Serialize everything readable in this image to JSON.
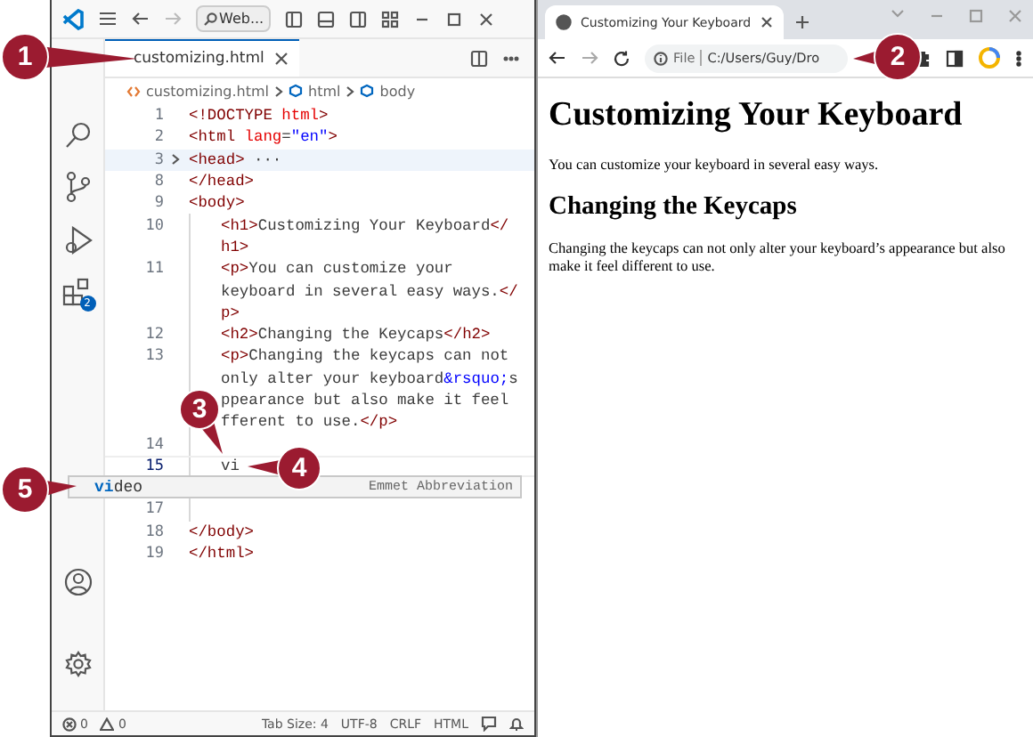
{
  "editor": {
    "title_bar": {
      "search": "Web..."
    },
    "tabs": [
      {
        "label": "customizing.html",
        "selected": true
      }
    ],
    "breadcrumb": [
      "customizing.html",
      "html",
      "body"
    ],
    "activity_bar": {
      "extensions_badge": "2"
    },
    "code_rows": [
      {
        "number": "1",
        "indented": false,
        "folded": false,
        "current": false,
        "tokens": [
          {
            "kind": "tag",
            "text": "<!DOCTYPE "
          },
          {
            "kind": "attr",
            "text": "html"
          },
          {
            "kind": "tag",
            "text": ">"
          }
        ]
      },
      {
        "number": "2",
        "indented": false,
        "folded": false,
        "current": false,
        "tokens": [
          {
            "kind": "tag",
            "text": "<html "
          },
          {
            "kind": "attr",
            "text": "lang"
          },
          {
            "kind": "text",
            "text": "="
          },
          {
            "kind": "string",
            "text": "\"en\""
          },
          {
            "kind": "tag",
            "text": ">"
          }
        ]
      },
      {
        "number": "3",
        "indented": false,
        "folded": true,
        "current": false,
        "tokens": [
          {
            "kind": "tag",
            "text": "<head>"
          },
          {
            "kind": "text",
            "text": " ···"
          }
        ]
      },
      {
        "number": "8",
        "indented": false,
        "folded": false,
        "current": false,
        "tokens": [
          {
            "kind": "tag",
            "text": "</head>"
          }
        ]
      },
      {
        "number": "9",
        "indented": false,
        "folded": false,
        "current": false,
        "tokens": [
          {
            "kind": "tag",
            "text": "<body>"
          }
        ]
      },
      {
        "number": "10",
        "indented": true,
        "folded": false,
        "current": false,
        "tokens": [
          {
            "kind": "tag",
            "text": "<h1>"
          },
          {
            "kind": "text",
            "text": "Customizing Your Keyboard"
          },
          {
            "kind": "tag",
            "text": "</"
          }
        ]
      },
      {
        "indented": true,
        "folded": false,
        "current": false,
        "tokens": [
          {
            "kind": "tag",
            "text": "h1>"
          }
        ]
      },
      {
        "number": "11",
        "indented": true,
        "folded": false,
        "current": false,
        "tokens": [
          {
            "kind": "tag",
            "text": "<p>"
          },
          {
            "kind": "text",
            "text": "You can customize your"
          }
        ]
      },
      {
        "indented": true,
        "folded": false,
        "current": false,
        "tokens": [
          {
            "kind": "text",
            "text": "keyboard in several easy ways."
          },
          {
            "kind": "tag",
            "text": "</"
          }
        ]
      },
      {
        "indented": true,
        "folded": false,
        "current": false,
        "tokens": [
          {
            "kind": "tag",
            "text": "p>"
          }
        ]
      },
      {
        "number": "12",
        "indented": true,
        "folded": false,
        "current": false,
        "tokens": [
          {
            "kind": "tag",
            "text": "<h2>"
          },
          {
            "kind": "text",
            "text": "Changing the Keycaps"
          },
          {
            "kind": "tag",
            "text": "</h2>"
          }
        ]
      },
      {
        "number": "13",
        "indented": true,
        "folded": false,
        "current": false,
        "tokens": [
          {
            "kind": "tag",
            "text": "<p>"
          },
          {
            "kind": "text",
            "text": "Changing the keycaps can not"
          }
        ]
      },
      {
        "indented": true,
        "folded": false,
        "current": false,
        "tokens": [
          {
            "kind": "text",
            "text": "only alter your keyboard"
          },
          {
            "kind": "entity",
            "text": "&rsquo;"
          },
          {
            "kind": "text",
            "text": "s"
          }
        ]
      },
      {
        "indented": true,
        "folded": false,
        "current": false,
        "tokens": [
          {
            "kind": "text",
            "text": "ppearance but also make it feel"
          }
        ]
      },
      {
        "indented": true,
        "folded": false,
        "current": false,
        "tokens": [
          {
            "kind": "text",
            "text": "fferent to use."
          },
          {
            "kind": "tag",
            "text": "</p>"
          }
        ]
      },
      {
        "number": "14",
        "indented": true,
        "folded": false,
        "current": false,
        "tokens": []
      },
      {
        "number": "15",
        "indented": true,
        "folded": false,
        "current": true,
        "tokens": [
          {
            "kind": "text",
            "text": "vi"
          }
        ]
      },
      {
        "number": "17",
        "indented": true,
        "folded": false,
        "current": false,
        "tokens": []
      },
      {
        "number": "18",
        "indented": false,
        "folded": false,
        "current": false,
        "tokens": [
          {
            "kind": "tag",
            "text": "</body>"
          }
        ]
      },
      {
        "number": "19",
        "indented": false,
        "folded": false,
        "current": false,
        "tokens": [
          {
            "kind": "tag",
            "text": "</html>"
          }
        ]
      }
    ],
    "suggestion": {
      "label": "**vi**deo",
      "detail": "Emmet Abbreviation"
    },
    "status_bar": {
      "errors": "0",
      "warnings": "0",
      "items": [
        "Tab Size: 4",
        "UTF-8",
        "CRLF",
        "HTML"
      ]
    }
  },
  "browser": {
    "tab": {
      "title": "Customizing Your Keyboard"
    },
    "address": {
      "scheme": "File",
      "path": "C:/Users/Guy/Dro"
    },
    "page": [
      {
        "kind": "h1",
        "text": "Customizing Your Keyboard"
      },
      {
        "kind": "p",
        "text": "You can customize your keyboard in several easy ways."
      },
      {
        "kind": "h2",
        "text": "Changing the Keycaps"
      },
      {
        "kind": "p",
        "text": "Changing the keycaps can not only alter your keyboard’s appearance but also make it feel different to use."
      }
    ]
  },
  "callouts": [
    {
      "number": "1"
    },
    {
      "number": "2"
    },
    {
      "number": "3"
    },
    {
      "number": "4"
    },
    {
      "number": "5"
    }
  ]
}
